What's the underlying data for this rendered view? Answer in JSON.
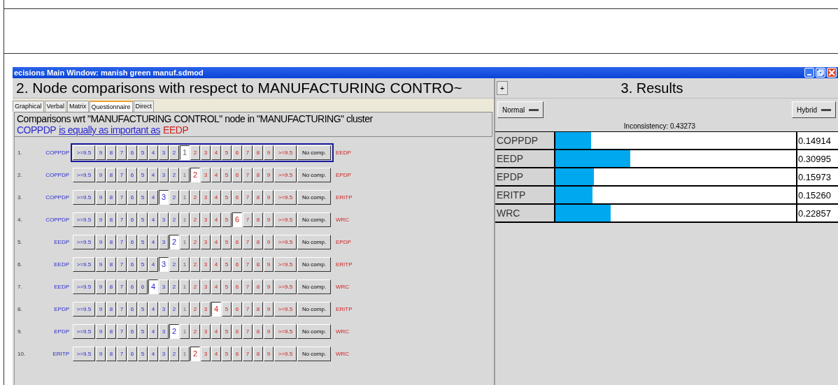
{
  "window": {
    "title": "ecisions Main Window: manish green manuf.sdmod"
  },
  "comparisons": {
    "title": "2. Node comparisons with respect to MANUFACTURING CONTRO~",
    "expand_button": "+",
    "tabs": [
      {
        "label": "Graphical",
        "selected": false
      },
      {
        "label": "Verbal",
        "selected": false
      },
      {
        "label": "Matrix",
        "selected": false
      },
      {
        "label": "Questionnaire",
        "selected": true
      },
      {
        "label": "Direct",
        "selected": false
      }
    ],
    "heading": "Comparisons wrt \"MANUFACTURING CONTROL\" node in \"MANUFACTURING\" cluster",
    "verdict": {
      "left": "COPPDP",
      "middle": "is equally as important as",
      "right": "EEDP"
    },
    "rows": [
      {
        "number": "1.",
        "left": "COPPDP",
        "right": "EEDP",
        "focused": true,
        "no_comp": "No comp.",
        "buttons": [
          {
            "label": ">=9.5",
            "selected": false
          },
          {
            "label": "9",
            "selected": false
          },
          {
            "label": "8",
            "selected": false
          },
          {
            "label": "7",
            "selected": false
          },
          {
            "label": "6",
            "selected": false
          },
          {
            "label": "5",
            "selected": false
          },
          {
            "label": "4",
            "selected": false
          },
          {
            "label": "3",
            "selected": false
          },
          {
            "label": "2",
            "selected": false
          },
          {
            "label": "1",
            "selected": true
          },
          {
            "label": "2",
            "selected": false
          },
          {
            "label": "3",
            "selected": false
          },
          {
            "label": "4",
            "selected": false
          },
          {
            "label": "5",
            "selected": false
          },
          {
            "label": "6",
            "selected": false
          },
          {
            "label": "7",
            "selected": false
          },
          {
            "label": "8",
            "selected": false
          },
          {
            "label": "9",
            "selected": false
          },
          {
            "label": ">=9.5",
            "selected": false
          }
        ]
      },
      {
        "number": "2.",
        "left": "COPPDP",
        "right": "EPDP",
        "focused": false,
        "no_comp": "No comp.",
        "buttons": [
          {
            "label": ">=9.5",
            "selected": false
          },
          {
            "label": "9",
            "selected": false
          },
          {
            "label": "8",
            "selected": false
          },
          {
            "label": "7",
            "selected": false
          },
          {
            "label": "6",
            "selected": false
          },
          {
            "label": "5",
            "selected": false
          },
          {
            "label": "4",
            "selected": false
          },
          {
            "label": "3",
            "selected": false
          },
          {
            "label": "2",
            "selected": false
          },
          {
            "label": "1",
            "selected": false
          },
          {
            "label": "2",
            "selected": true
          },
          {
            "label": "3",
            "selected": false
          },
          {
            "label": "4",
            "selected": false
          },
          {
            "label": "5",
            "selected": false
          },
          {
            "label": "6",
            "selected": false
          },
          {
            "label": "7",
            "selected": false
          },
          {
            "label": "8",
            "selected": false
          },
          {
            "label": "9",
            "selected": false
          },
          {
            "label": ">=9.5",
            "selected": false
          }
        ]
      },
      {
        "number": "3.",
        "left": "COPPDP",
        "right": "ERITP",
        "focused": false,
        "no_comp": "No comp.",
        "buttons": [
          {
            "label": ">=9.5",
            "selected": false
          },
          {
            "label": "9",
            "selected": false
          },
          {
            "label": "8",
            "selected": false
          },
          {
            "label": "7",
            "selected": false
          },
          {
            "label": "6",
            "selected": false
          },
          {
            "label": "5",
            "selected": false
          },
          {
            "label": "4",
            "selected": false
          },
          {
            "label": "3",
            "selected": true
          },
          {
            "label": "2",
            "selected": false
          },
          {
            "label": "1",
            "selected": false
          },
          {
            "label": "2",
            "selected": false
          },
          {
            "label": "3",
            "selected": false
          },
          {
            "label": "4",
            "selected": false
          },
          {
            "label": "5",
            "selected": false
          },
          {
            "label": "6",
            "selected": false
          },
          {
            "label": "7",
            "selected": false
          },
          {
            "label": "8",
            "selected": false
          },
          {
            "label": "9",
            "selected": false
          },
          {
            "label": ">=9.5",
            "selected": false
          }
        ]
      },
      {
        "number": "4.",
        "left": "COPPDP",
        "right": "WRC",
        "focused": false,
        "no_comp": "No comp.",
        "buttons": [
          {
            "label": ">=9.5",
            "selected": false
          },
          {
            "label": "9",
            "selected": false
          },
          {
            "label": "8",
            "selected": false
          },
          {
            "label": "7",
            "selected": false
          },
          {
            "label": "6",
            "selected": false
          },
          {
            "label": "5",
            "selected": false
          },
          {
            "label": "4",
            "selected": false
          },
          {
            "label": "3",
            "selected": false
          },
          {
            "label": "2",
            "selected": false
          },
          {
            "label": "1",
            "selected": false
          },
          {
            "label": "2",
            "selected": false
          },
          {
            "label": "3",
            "selected": false
          },
          {
            "label": "4",
            "selected": false
          },
          {
            "label": "5",
            "selected": false
          },
          {
            "label": "6",
            "selected": true
          },
          {
            "label": "7",
            "selected": false
          },
          {
            "label": "8",
            "selected": false
          },
          {
            "label": "9",
            "selected": false
          },
          {
            "label": ">=9.5",
            "selected": false
          }
        ]
      },
      {
        "number": "5.",
        "left": "EEDP",
        "right": "EPDP",
        "focused": false,
        "no_comp": "No comp.",
        "buttons": [
          {
            "label": ">=9.5",
            "selected": false
          },
          {
            "label": "9",
            "selected": false
          },
          {
            "label": "8",
            "selected": false
          },
          {
            "label": "7",
            "selected": false
          },
          {
            "label": "6",
            "selected": false
          },
          {
            "label": "5",
            "selected": false
          },
          {
            "label": "4",
            "selected": false
          },
          {
            "label": "3",
            "selected": false
          },
          {
            "label": "2",
            "selected": true
          },
          {
            "label": "1",
            "selected": false
          },
          {
            "label": "2",
            "selected": false
          },
          {
            "label": "3",
            "selected": false
          },
          {
            "label": "4",
            "selected": false
          },
          {
            "label": "5",
            "selected": false
          },
          {
            "label": "6",
            "selected": false
          },
          {
            "label": "7",
            "selected": false
          },
          {
            "label": "8",
            "selected": false
          },
          {
            "label": "9",
            "selected": false
          },
          {
            "label": ">=9.5",
            "selected": false
          }
        ]
      },
      {
        "number": "6.",
        "left": "EEDP",
        "right": "ERITP",
        "focused": false,
        "no_comp": "No comp.",
        "buttons": [
          {
            "label": ">=9.5",
            "selected": false
          },
          {
            "label": "9",
            "selected": false
          },
          {
            "label": "8",
            "selected": false
          },
          {
            "label": "7",
            "selected": false
          },
          {
            "label": "6",
            "selected": false
          },
          {
            "label": "5",
            "selected": false
          },
          {
            "label": "4",
            "selected": false
          },
          {
            "label": "3",
            "selected": true
          },
          {
            "label": "2",
            "selected": false
          },
          {
            "label": "1",
            "selected": false
          },
          {
            "label": "2",
            "selected": false
          },
          {
            "label": "3",
            "selected": false
          },
          {
            "label": "4",
            "selected": false
          },
          {
            "label": "5",
            "selected": false
          },
          {
            "label": "6",
            "selected": false
          },
          {
            "label": "7",
            "selected": false
          },
          {
            "label": "8",
            "selected": false
          },
          {
            "label": "9",
            "selected": false
          },
          {
            "label": ">=9.5",
            "selected": false
          }
        ]
      },
      {
        "number": "7.",
        "left": "EEDP",
        "right": "WRC",
        "focused": false,
        "no_comp": "No comp.",
        "buttons": [
          {
            "label": ">=9.5",
            "selected": false
          },
          {
            "label": "9",
            "selected": false
          },
          {
            "label": "8",
            "selected": false
          },
          {
            "label": "7",
            "selected": false
          },
          {
            "label": "6",
            "selected": false
          },
          {
            "label": "6",
            "selected": false
          },
          {
            "label": "4",
            "selected": true
          },
          {
            "label": "3",
            "selected": false
          },
          {
            "label": "2",
            "selected": false
          },
          {
            "label": "1",
            "selected": false
          },
          {
            "label": "2",
            "selected": false
          },
          {
            "label": "3",
            "selected": false
          },
          {
            "label": "4",
            "selected": false
          },
          {
            "label": "5",
            "selected": false
          },
          {
            "label": "6",
            "selected": false
          },
          {
            "label": "7",
            "selected": false
          },
          {
            "label": "8",
            "selected": false
          },
          {
            "label": "9",
            "selected": false
          },
          {
            "label": ">=9.5",
            "selected": false
          }
        ]
      },
      {
        "number": "8.",
        "left": "EPDP",
        "right": "ERITP",
        "focused": false,
        "no_comp": "No comp.",
        "buttons": [
          {
            "label": ">=9.5",
            "selected": false
          },
          {
            "label": "9",
            "selected": false
          },
          {
            "label": "8",
            "selected": false
          },
          {
            "label": "7",
            "selected": false
          },
          {
            "label": "6",
            "selected": false
          },
          {
            "label": "5",
            "selected": false
          },
          {
            "label": "4",
            "selected": false
          },
          {
            "label": "3",
            "selected": false
          },
          {
            "label": "2",
            "selected": false
          },
          {
            "label": "1",
            "selected": false
          },
          {
            "label": "2",
            "selected": false
          },
          {
            "label": "3",
            "selected": false
          },
          {
            "label": "4",
            "selected": true
          },
          {
            "label": "5",
            "selected": false
          },
          {
            "label": "6",
            "selected": false
          },
          {
            "label": "7",
            "selected": false
          },
          {
            "label": "8",
            "selected": false
          },
          {
            "label": "9",
            "selected": false
          },
          {
            "label": ">=9.5",
            "selected": false
          }
        ]
      },
      {
        "number": "9.",
        "left": "EPDP",
        "right": "WRC",
        "focused": false,
        "no_comp": "No comp.",
        "buttons": [
          {
            "label": ">=9.5",
            "selected": false
          },
          {
            "label": "9",
            "selected": false
          },
          {
            "label": "8",
            "selected": false
          },
          {
            "label": "7",
            "selected": false
          },
          {
            "label": "6",
            "selected": false
          },
          {
            "label": "5",
            "selected": false
          },
          {
            "label": "4",
            "selected": false
          },
          {
            "label": "3",
            "selected": false
          },
          {
            "label": "2",
            "selected": true
          },
          {
            "label": "1",
            "selected": false
          },
          {
            "label": "2",
            "selected": false
          },
          {
            "label": "3",
            "selected": false
          },
          {
            "label": "4",
            "selected": false
          },
          {
            "label": "5",
            "selected": false
          },
          {
            "label": "6",
            "selected": false
          },
          {
            "label": "7",
            "selected": false
          },
          {
            "label": "8",
            "selected": false
          },
          {
            "label": "9",
            "selected": false
          },
          {
            "label": ">=9.5",
            "selected": false
          }
        ]
      },
      {
        "number": "10.",
        "left": "ERITP",
        "right": "WRC",
        "focused": false,
        "no_comp": "No comp.",
        "buttons": [
          {
            "label": ">=9.5",
            "selected": false
          },
          {
            "label": "9",
            "selected": false
          },
          {
            "label": "8",
            "selected": false
          },
          {
            "label": "7",
            "selected": false
          },
          {
            "label": "6",
            "selected": false
          },
          {
            "label": "5",
            "selected": false
          },
          {
            "label": "4",
            "selected": false
          },
          {
            "label": "3",
            "selected": false
          },
          {
            "label": "2",
            "selected": false
          },
          {
            "label": "1",
            "selected": false
          },
          {
            "label": "2",
            "selected": true
          },
          {
            "label": "3",
            "selected": false
          },
          {
            "label": "4",
            "selected": false
          },
          {
            "label": "5",
            "selected": false
          },
          {
            "label": "6",
            "selected": false
          },
          {
            "label": "7",
            "selected": false
          },
          {
            "label": "8",
            "selected": false
          },
          {
            "label": "9",
            "selected": false
          },
          {
            "label": ">=9.5",
            "selected": false
          }
        ]
      }
    ]
  },
  "results": {
    "title": "3. Results",
    "mode_left": "Normal",
    "mode_right": "Hybrid",
    "inconsistency": "Inconsistency: 0.43273",
    "rows": [
      {
        "name": "COPPDP",
        "level": 0.149,
        "value": "0.14914"
      },
      {
        "name": "EEDP",
        "level": 0.31,
        "value": "0.30995"
      },
      {
        "name": "EPDP",
        "level": 0.16,
        "value": "0.15973"
      },
      {
        "name": "ERITP",
        "level": 0.153,
        "value": "0.15260"
      },
      {
        "name": "WRC",
        "level": 0.229,
        "value": "0.22857"
      }
    ]
  }
}
